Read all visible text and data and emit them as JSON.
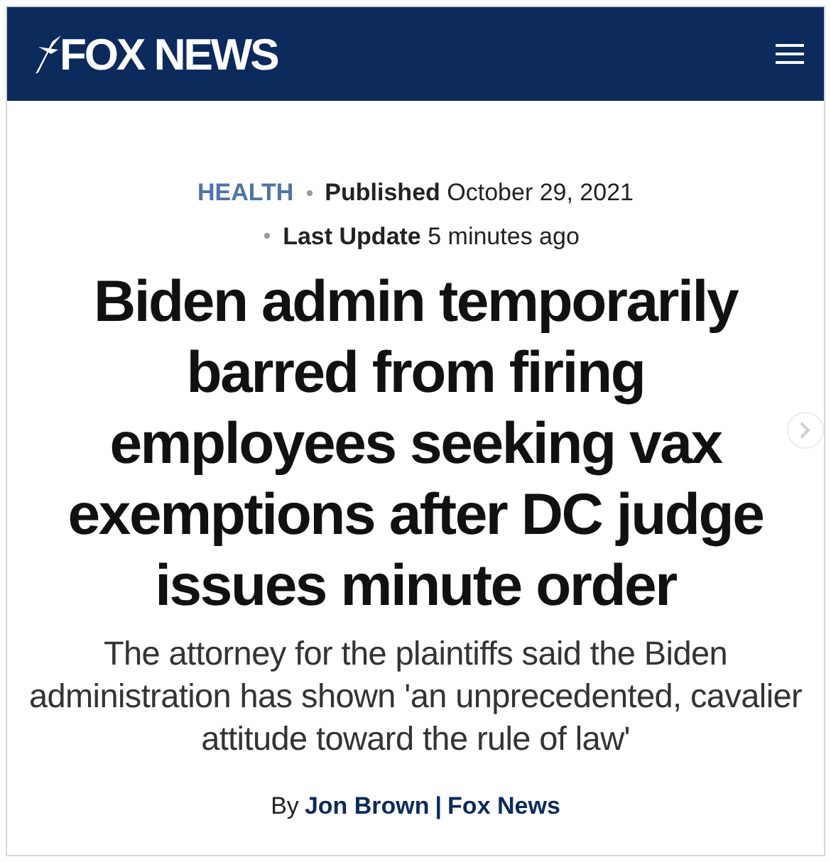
{
  "header": {
    "logo": "FOX NEWS"
  },
  "article": {
    "category": "HEALTH",
    "published": "**Published** October 29, 2021",
    "updated": "**Last Update** 5 minutes ago",
    "headline": "Biden admin temporarily barred from firing employees seeking vax exemptions after DC judge issues minute order",
    "subheadline": "The attorney for the plaintiffs said the Biden administration has shown 'an unprecedented, cavalier attitude toward the rule of law'",
    "byline": {
      "prefix": "By",
      "author": "Jon Brown",
      "separator": "|",
      "outlet": "Fox News"
    }
  }
}
